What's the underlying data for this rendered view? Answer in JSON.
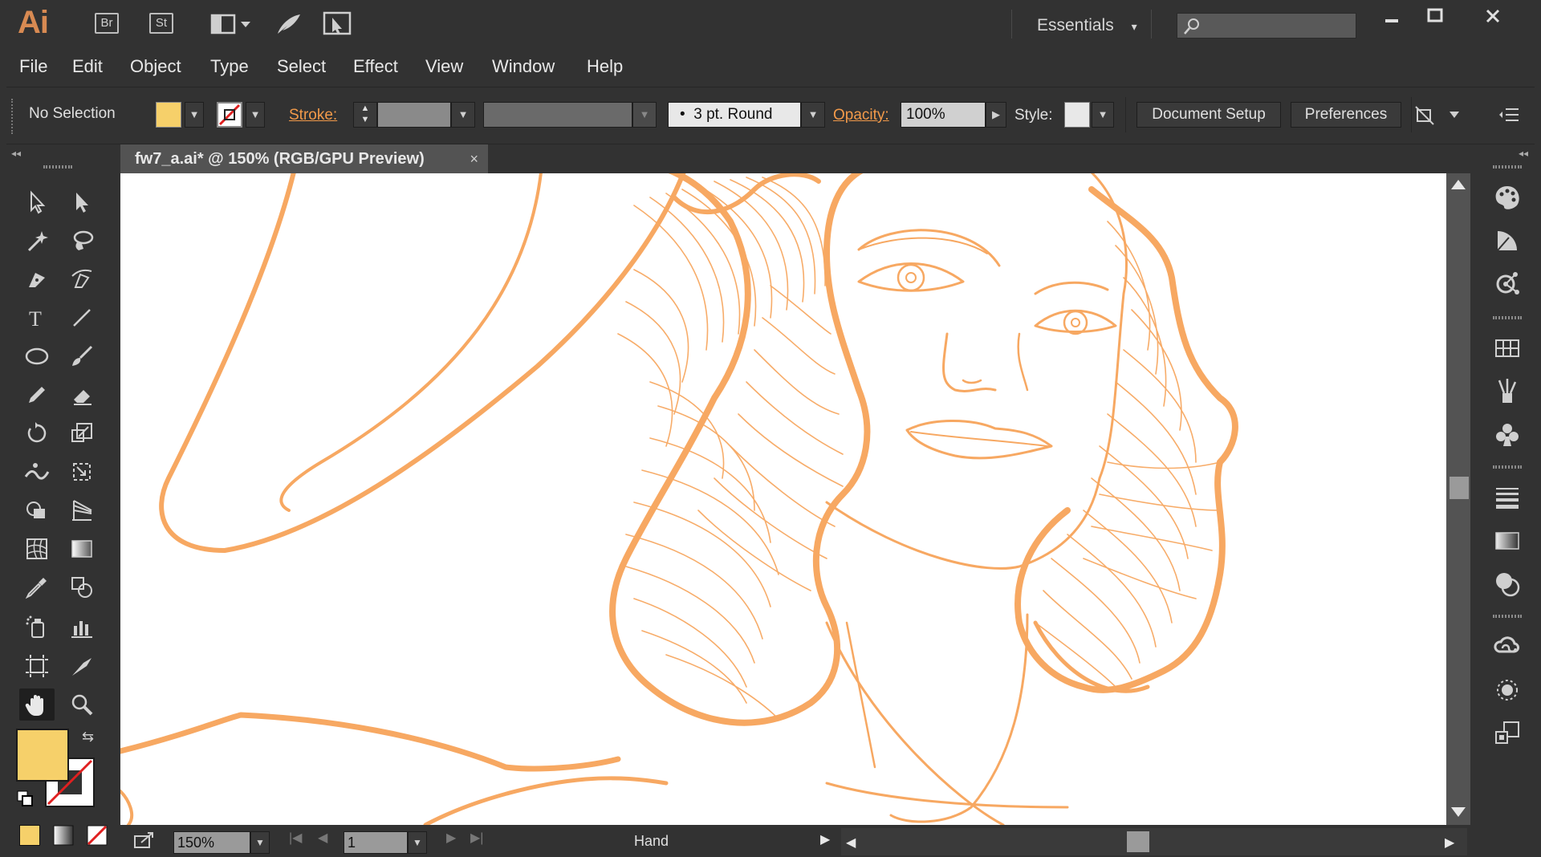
{
  "app": {
    "logo": "Ai",
    "bridge_label": "Br",
    "stock_label": "St",
    "workspace": "Essentials",
    "search_placeholder": "",
    "accent_color": "#f29a4a"
  },
  "menu": [
    "File",
    "Edit",
    "Object",
    "Type",
    "Select",
    "Effect",
    "View",
    "Window",
    "Help"
  ],
  "control": {
    "selection_label": "No Selection",
    "fill_color": "#f6d06a",
    "stroke_label": "Stroke:",
    "brush_label": "3 pt. Round",
    "opacity_label": "Opacity:",
    "opacity_value": "100%",
    "style_label": "Style:",
    "document_setup": "Document Setup",
    "preferences": "Preferences"
  },
  "document": {
    "tab_title": "fw7_a.ai* @ 150% (RGB/GPU Preview)",
    "close_glyph": "×",
    "line_color": "#f7a862"
  },
  "status": {
    "zoom": "150%",
    "artboard": "1",
    "tool_name": "Hand"
  },
  "toolbar": {
    "fill_color": "#f6d06a",
    "stroke_color": "#ffffff"
  }
}
